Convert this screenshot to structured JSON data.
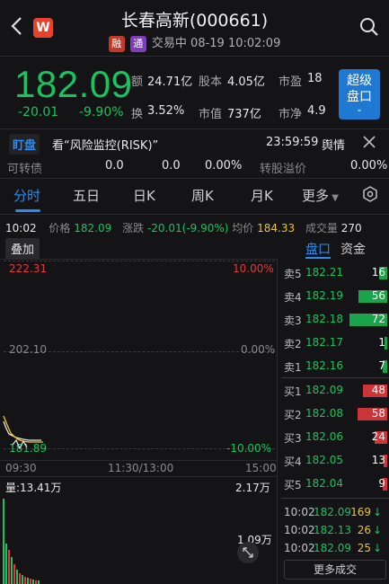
{
  "header": {
    "title": "长春高新(000661)",
    "tag_rong": "融",
    "tag_tong": "通",
    "status": "交易中 08-19 10:02:09",
    "logo_letter": "W"
  },
  "quote": {
    "price": "182.09",
    "change": "-20.01",
    "change_pct": "-9.90%",
    "amount_label": "额",
    "amount": "24.71亿",
    "shares_label": "股本",
    "shares": "4.05亿",
    "pe_label": "市盈",
    "pe": "18",
    "turnover_label": "换",
    "turnover": "3.52%",
    "mcap_label": "市值",
    "mcap": "737亿",
    "pb_label": "市净",
    "pb": "4.9",
    "super_button": [
      "超级",
      "盘口"
    ]
  },
  "alert": {
    "tag": "盯盘",
    "text": "看“风险监控(RISK)”",
    "time": "23:59:59",
    "tail": "舆情"
  },
  "bond": {
    "label": "可转债",
    "v1": "0.0",
    "v2": "0.0",
    "v3": "0.00%",
    "premium_label": "转股溢价",
    "premium": "0.00%"
  },
  "tabs": [
    "分时",
    "五日",
    "日K",
    "周K",
    "月K",
    "更多"
  ],
  "info_bar": {
    "time": "10:02",
    "price_label": "价格",
    "price": "182.09",
    "change_label": "涨跌",
    "change": "-20.01(-9.90%)",
    "avg_label": "均价",
    "avg": "184.33",
    "vol_label": "成交量",
    "vol": "270"
  },
  "chart": {
    "overlay_button": "叠加",
    "y_high": "222.31",
    "pct_high": "10.00%",
    "y_mid": "202.10",
    "pct_mid": "0.00%",
    "y_low": "181.89",
    "pct_low": "-10.00%",
    "x_start": "09:30",
    "x_mid": "11:30/13:00",
    "x_end": "15:00",
    "volume_label": "量:13.41万",
    "vol_max": "2.17万",
    "vol_mid": "1.09万"
  },
  "book_tabs": [
    "盘口",
    "资金"
  ],
  "asks": [
    {
      "label": "卖5",
      "price": "182.21",
      "qty": "16",
      "fill": 0.12
    },
    {
      "label": "卖4",
      "price": "182.19",
      "qty": "56",
      "fill": 0.42
    },
    {
      "label": "卖3",
      "price": "182.18",
      "qty": "72",
      "fill": 0.55
    },
    {
      "label": "卖2",
      "price": "182.17",
      "qty": "1",
      "fill": 0.02
    },
    {
      "label": "卖1",
      "price": "182.16",
      "qty": "7",
      "fill": 0.06
    }
  ],
  "bids": [
    {
      "label": "买1",
      "price": "182.09",
      "qty": "48",
      "fill": 0.36
    },
    {
      "label": "买2",
      "price": "182.08",
      "qty": "58",
      "fill": 0.44
    },
    {
      "label": "买3",
      "price": "182.06",
      "qty": "24",
      "fill": 0.18
    },
    {
      "label": "买4",
      "price": "182.05",
      "qty": "13",
      "fill": 0.05
    },
    {
      "label": "买5",
      "price": "182.04",
      "qty": "9",
      "fill": 0.06
    }
  ],
  "trades": [
    {
      "time": "10:02",
      "price": "182.09",
      "qty": "169",
      "dir": "down"
    },
    {
      "time": "10:02",
      "price": "182.13",
      "qty": "26",
      "dir": "down"
    },
    {
      "time": "10:02",
      "price": "182.09",
      "qty": "25",
      "dir": "down"
    }
  ],
  "more_trades": "更多成交",
  "colors": {
    "up": "#e5373d",
    "down": "#19c35f",
    "accent": "#2a8cf0",
    "bg": "#141416"
  }
}
